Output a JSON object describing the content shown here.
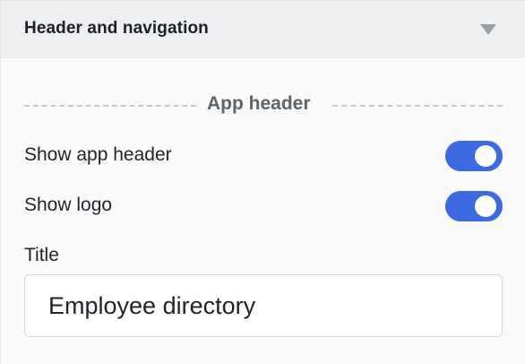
{
  "section": {
    "title": "Header and navigation"
  },
  "app_header_group": {
    "label": "App header"
  },
  "settings": {
    "show_app_header": {
      "label": "Show app header",
      "checked": true
    },
    "show_logo": {
      "label": "Show logo",
      "checked": true
    }
  },
  "title_field": {
    "label": "Title",
    "value": "Employee directory"
  },
  "colors": {
    "toggle_on": "#3c6ae2",
    "header_bg": "#eeeff1",
    "panel_bg": "#fafafa"
  },
  "icons": {
    "collapse": "chevron-down-icon"
  }
}
